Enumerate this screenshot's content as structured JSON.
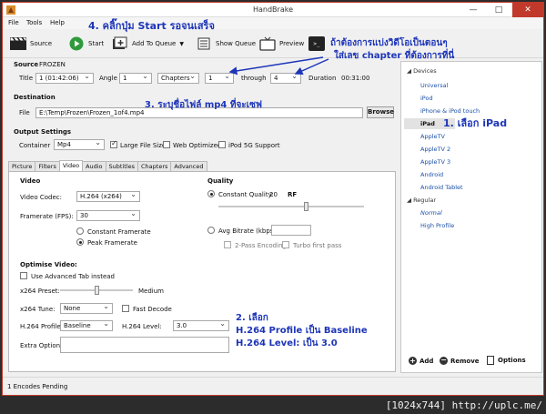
{
  "window": {
    "title": "HandBrake",
    "min": "—",
    "max": "□",
    "close": "✕"
  },
  "menu": [
    "File",
    "Tools",
    "Help"
  ],
  "toolbar": {
    "source": "Source",
    "start": "Start",
    "add_to_queue": "Add To Queue",
    "show_queue": "Show Queue",
    "preview": "Preview",
    "terminal_prompt": ">_"
  },
  "source": {
    "section": "Source",
    "name": "FROZEN",
    "title_label": "Title",
    "title_value": "1 (01:42:06)",
    "angle_label": "Angle",
    "angle_value": "1",
    "range_type": "Chapters",
    "from": "1",
    "through_label": "through",
    "to": "4",
    "duration_label": "Duration",
    "duration_value": "00:31:00"
  },
  "destination": {
    "section": "Destination",
    "file_label": "File",
    "file_value": "E:\\Temp\\Frozen\\Frozen_1of4.mp4",
    "browse": "Browse"
  },
  "output": {
    "section": "Output Settings",
    "container_label": "Container",
    "container_value": "Mp4",
    "large_file": "Large File Size",
    "web_optimized": "Web Optimized",
    "ipod_5g": "iPod 5G Support"
  },
  "tabs": [
    "Picture",
    "Filters",
    "Video",
    "Audio",
    "Subtitles",
    "Chapters",
    "Advanced"
  ],
  "video": {
    "section": "Video",
    "codec_label": "Video Codec:",
    "codec_value": "H.264 (x264)",
    "fps_label": "Framerate (FPS):",
    "fps_value": "30",
    "constant_framerate": "Constant Framerate",
    "peak_framerate": "Peak Framerate"
  },
  "quality": {
    "section": "Quality",
    "constant_quality": "Constant Quality:",
    "cq_value": "20",
    "cq_unit": "RF",
    "avg_bitrate": "Avg Bitrate (kbps):",
    "two_pass": "2-Pass Encoding",
    "turbo": "Turbo first pass"
  },
  "optimise": {
    "section": "Optimise Video:",
    "advanced_tab": "Use Advanced Tab instead",
    "preset_label": "x264 Preset:",
    "preset_value": "Medium",
    "tune_label": "x264 Tune:",
    "tune_value": "None",
    "fast_decode": "Fast Decode",
    "profile_label": "H.264 Profile:",
    "profile_value": "Baseline",
    "level_label": "H.264 Level:",
    "level_value": "3.0",
    "extra_label": "Extra Options:"
  },
  "presets": {
    "devices_group": "Devices",
    "devices": [
      "Universal",
      "iPod",
      "iPhone & iPod touch",
      "iPad",
      "AppleTV",
      "AppleTV 2",
      "AppleTV 3",
      "Android",
      "Android Tablet"
    ],
    "regular_group": "Regular",
    "regular": [
      "Normal",
      "High Profile"
    ],
    "add": "Add",
    "remove": "Remove",
    "options": "Options"
  },
  "status": {
    "text": "1 Encodes Pending"
  },
  "annotations": {
    "a4": "4. คลิ๊กปุ่ม Start รอจนเสร็จ",
    "chapter1": "ถ้าต้องการแบ่งวิดีโอเป็นตอนๆ",
    "chapter2": "ใส่เลข chapter ที่ต้องการที่นี่",
    "a3": "3. ระบุชื่อไฟล์ mp4 ที่จะเซฟ",
    "a1": "1. เลือก iPad",
    "a2_title": "2. เลือก",
    "a2_profile": "H.264 Profile เป็น Baseline",
    "a2_level": "H.264 Level: เป็น 3.0",
    "color": "#1d35b8"
  },
  "watermark": "[1024x744] http://uplc.me/"
}
